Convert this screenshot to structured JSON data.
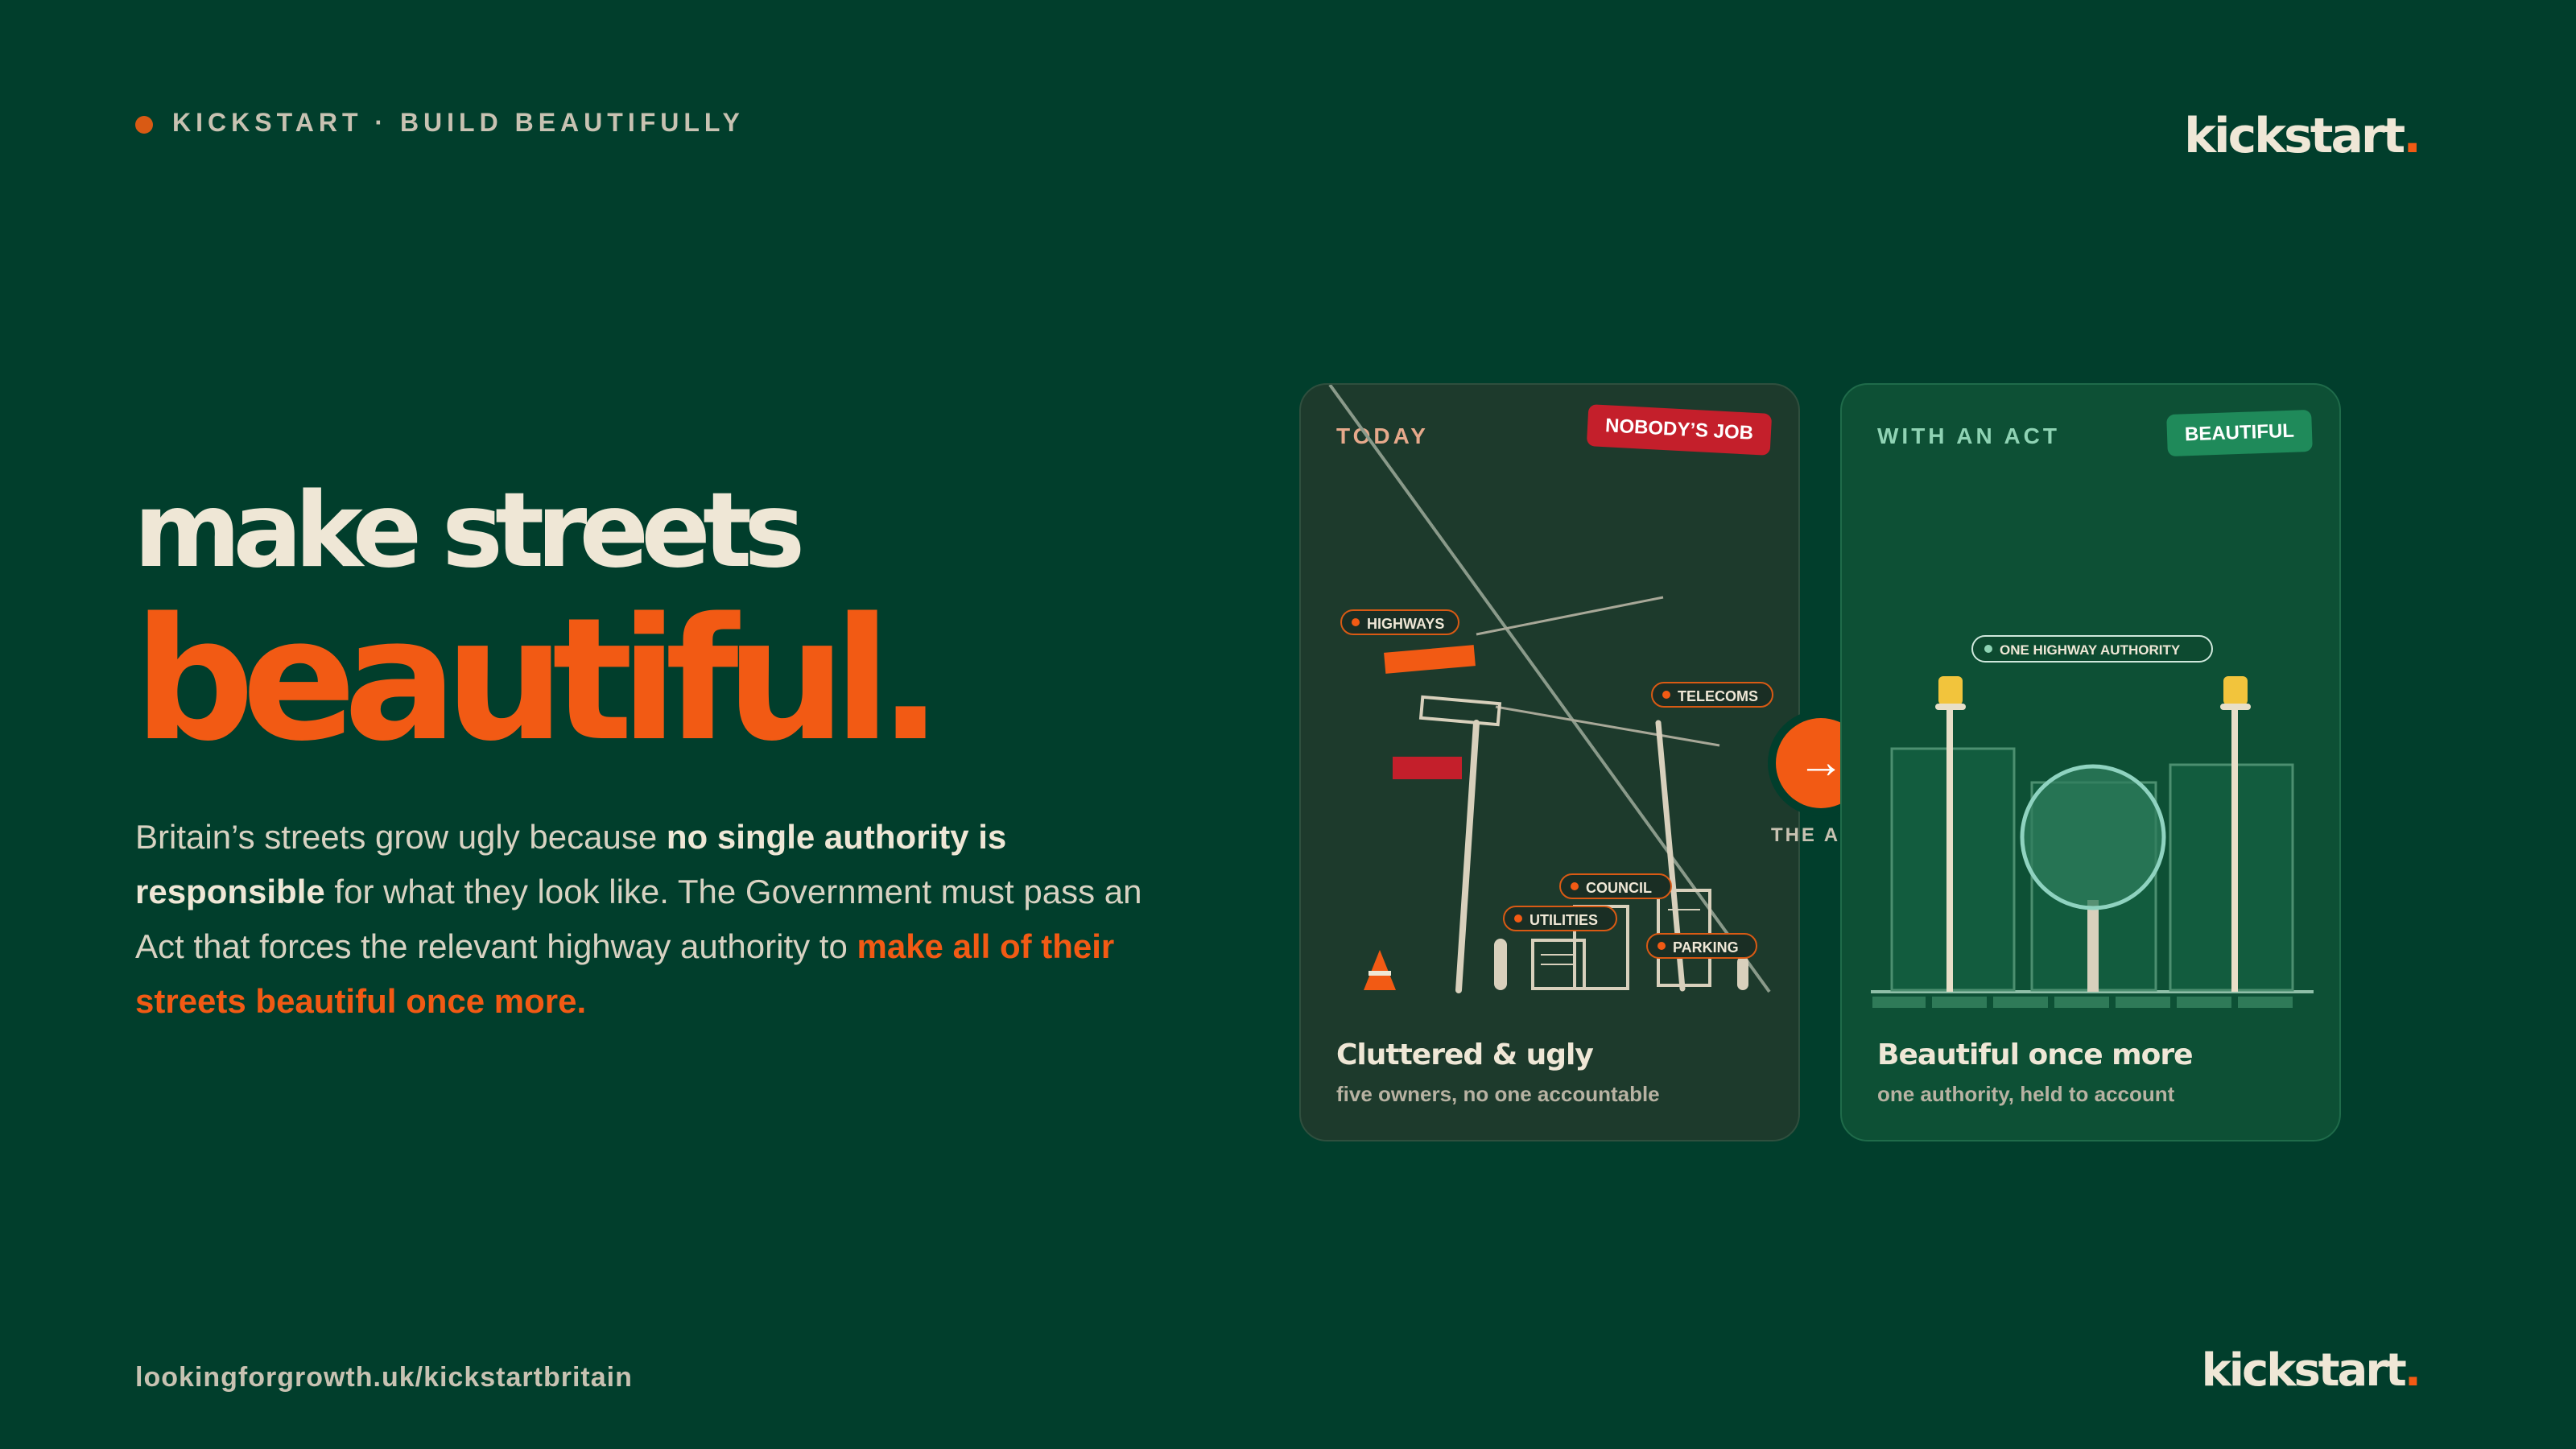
{
  "header": {
    "kicker": "KICKSTART · BUILD BEAUTIFULLY",
    "logo_text": "kickstart",
    "logo_period": "."
  },
  "headline": {
    "line1": "make streets",
    "line2": "beautiful."
  },
  "body": {
    "part1": "Britain’s streets grow ugly because ",
    "bold1": "no single authority is responsible",
    "part2": " for what they look like. The Government must pass an Act that forces the relevant highway authority to ",
    "highlight": "make all of their streets beautiful once more."
  },
  "footer": {
    "url": "lookingforgrowth.uk/kickstartbritain",
    "logo_text": "kickstart",
    "logo_period": "."
  },
  "cards": {
    "today": {
      "label": "TODAY",
      "badge": "NOBODY’S JOB",
      "title": "Cluttered & ugly",
      "subtitle": "five owners, no one accountable",
      "tags": {
        "highways": "HIGHWAYS",
        "telecoms": "TELECOMS",
        "council": "COUNCIL",
        "utilities": "UTILITIES",
        "parking": "PARKING"
      }
    },
    "act": {
      "label": "WITH AN ACT",
      "badge": "BEAUTIFUL",
      "title": "Beautiful once more",
      "subtitle": "one authority, held to account",
      "tag": "ONE HIGHWAY AUTHORITY"
    }
  },
  "transition": {
    "arrow_icon": "→",
    "label": "THE ACT"
  },
  "colors": {
    "background": "#013e2c",
    "accent": "#f25a14",
    "cream": "#efe7d6",
    "warning_red": "#c41f2b",
    "success_green": "#1f8a5a"
  }
}
